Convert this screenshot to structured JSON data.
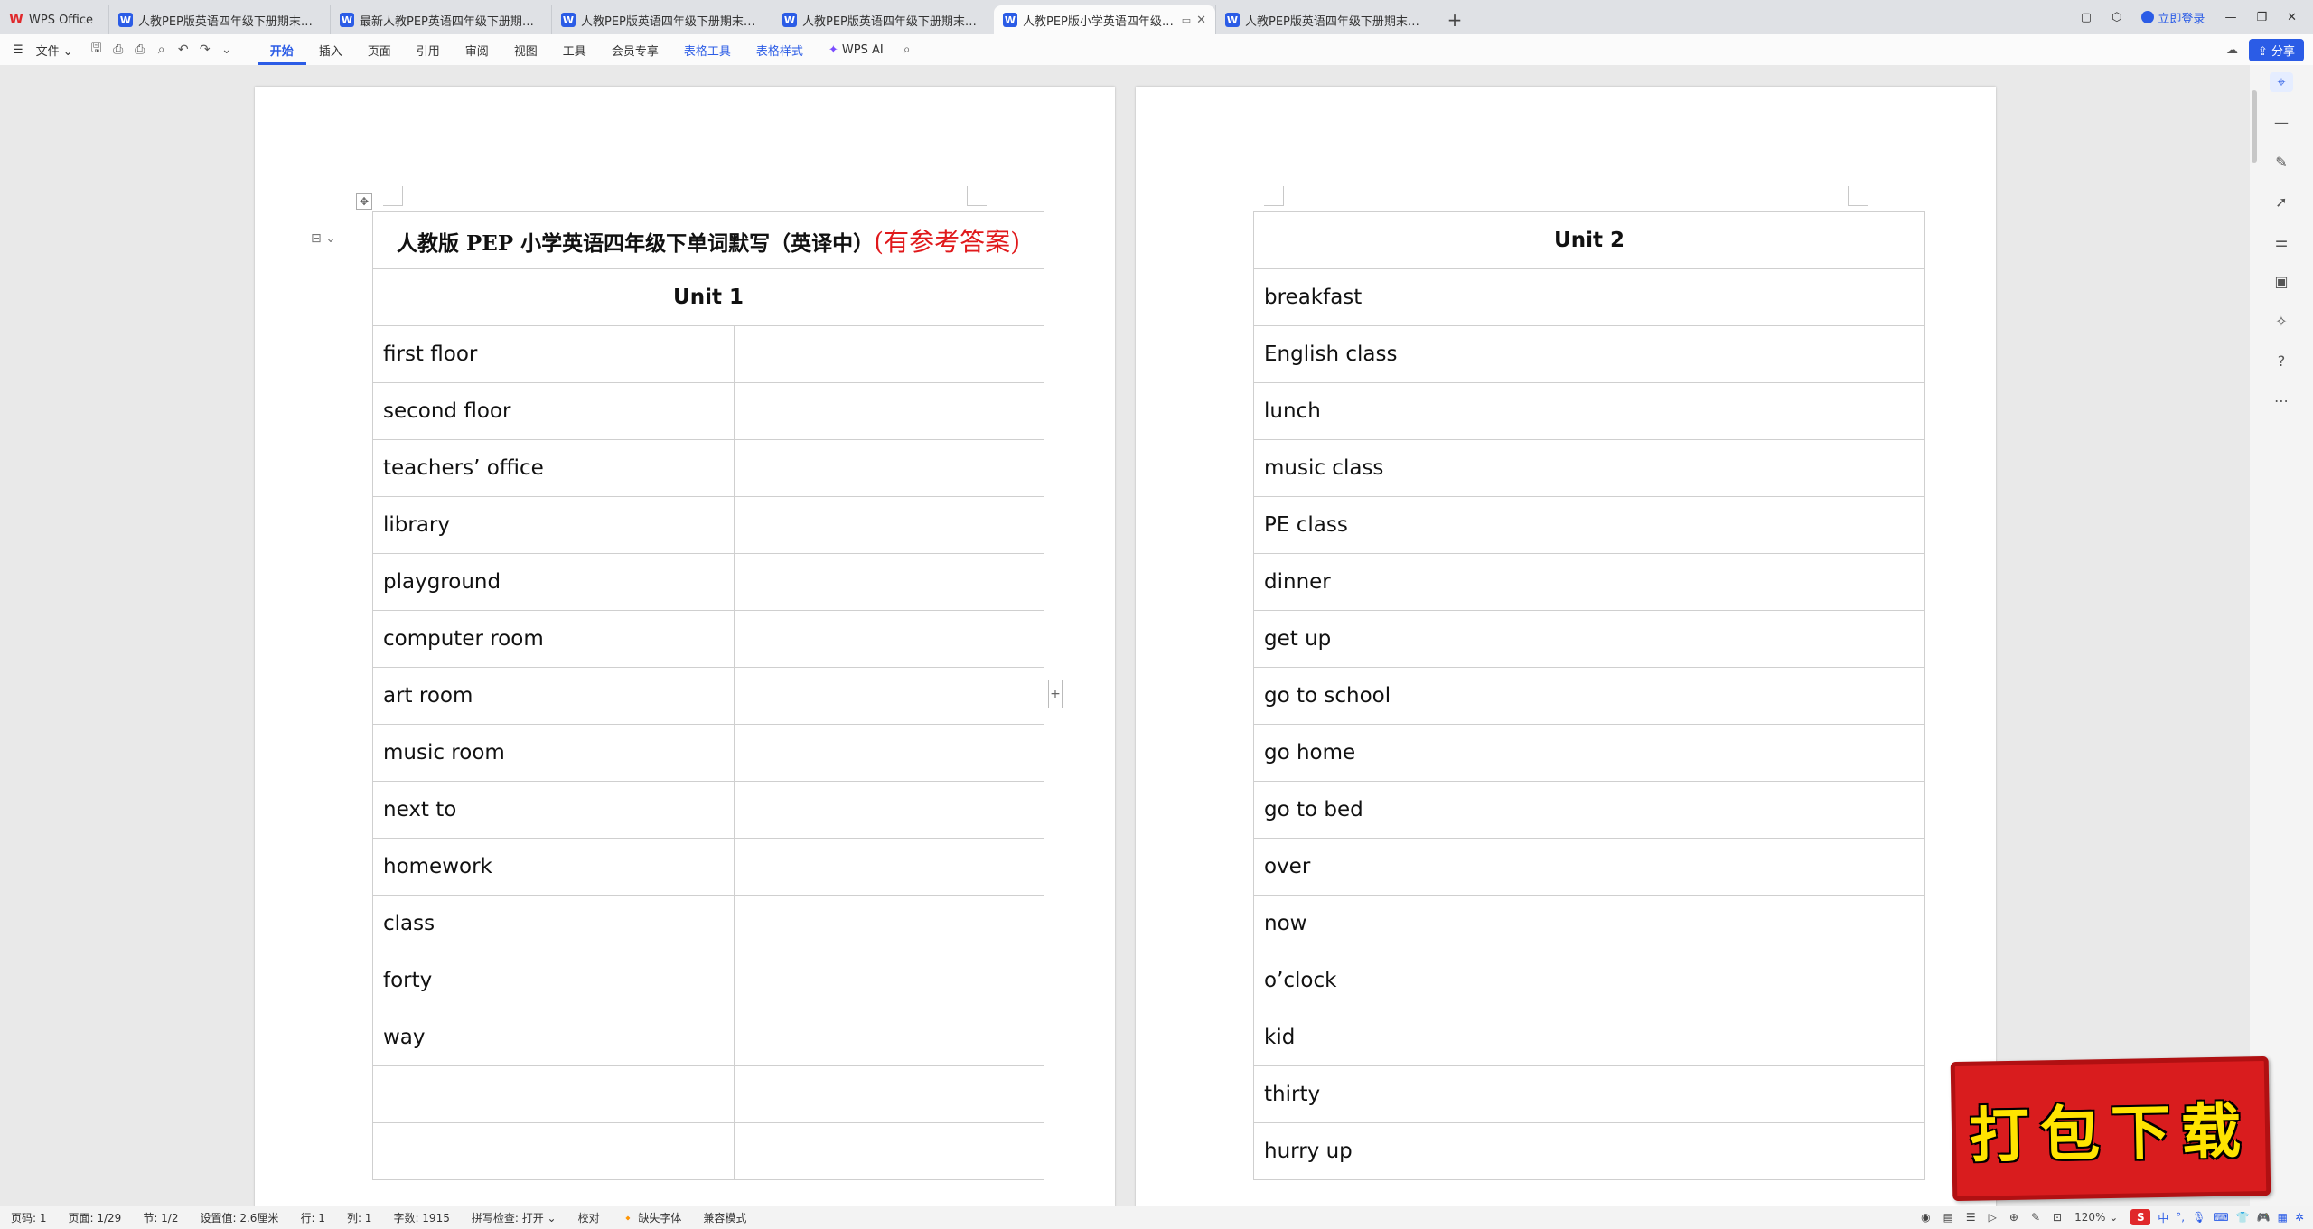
{
  "tabbar": {
    "home_label": "WPS Office",
    "tabs": [
      {
        "label": "人教PEP版英语四年级下册期末复习专项",
        "active": false
      },
      {
        "label": "最新人教PEP英语四年级下册期末复习",
        "active": false
      },
      {
        "label": "人教PEP版英语四年级下册期末复习专项",
        "active": false
      },
      {
        "label": "人教PEP版英语四年级下册期末复习专项",
        "active": false
      },
      {
        "label": "人教PEP版小学英语四年级下册",
        "active": true
      },
      {
        "label": "人教PEP版英语四年级下册期末复习专项",
        "active": false
      }
    ],
    "new_tab": "+",
    "login_label": "立即登录"
  },
  "menubar": {
    "file_label": "文件",
    "items": [
      "开始",
      "插入",
      "页面",
      "引用",
      "审阅",
      "视图",
      "工具",
      "会员专享",
      "表格工具",
      "表格样式"
    ],
    "active_item": "开始",
    "wps_ai_label": "WPS AI",
    "share_label": "分享"
  },
  "page1": {
    "title_main": "人教版 PEP 小学英语四年级下单词默写（英译中）",
    "title_red": "(有参考答案)",
    "unit": "Unit  1",
    "words": [
      "first  floor",
      "second  floor",
      "teachers’ office",
      "library",
      "playground",
      "computer  room",
      "art  room",
      "music  room",
      "next  to",
      "homework",
      "class",
      "forty",
      "way",
      "",
      ""
    ]
  },
  "page2": {
    "unit": "Unit  2",
    "words": [
      "breakfast",
      "English  class",
      "lunch",
      "music  class",
      "PE  class",
      "dinner",
      "get  up",
      "go  to  school",
      "go  home",
      "go  to  bed",
      "over",
      "now",
      "o’clock",
      "kid",
      "thirty",
      "hurry  up"
    ]
  },
  "statusbar": {
    "page_code": "页码: 1",
    "page": "页面: 1/29",
    "section": "节: 1/2",
    "position": "设置值: 2.6厘米",
    "row": "行: 1",
    "col": "列: 1",
    "word_count": "字数: 1915",
    "spell_check": "拼写检查: 打开",
    "proofread": "校对",
    "missing_font": "缺失字体",
    "compat_mode": "兼容模式",
    "zoom": "120%",
    "ime_logo": "S",
    "ime_lang": "中"
  },
  "promo": {
    "text": "打包下载"
  },
  "colors": {
    "accent": "#2b5ce6",
    "title_red": "#e0181b",
    "promo_red": "#d91c1e",
    "promo_yellow": "#ffe400"
  }
}
